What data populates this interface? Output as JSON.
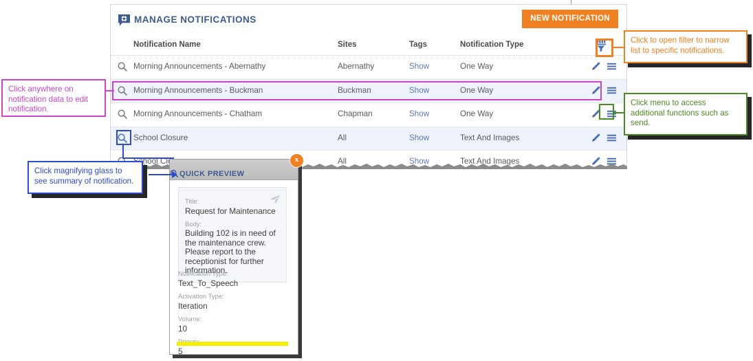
{
  "panel": {
    "title": "MANAGE NOTIFICATIONS",
    "title_icon": "speech-bubble-gear-icon",
    "new_button_label": "NEW NOTIFICATION",
    "filter_icon": "filter-funnel-icon"
  },
  "table": {
    "columns": [
      {
        "key": "name",
        "label": "Notification Name"
      },
      {
        "key": "sites",
        "label": "Sites"
      },
      {
        "key": "tags",
        "label": "Tags"
      },
      {
        "key": "type",
        "label": "Notification Type"
      }
    ],
    "rows": [
      {
        "name": "Morning Announcements - Abernathy",
        "sites": "Abernathy",
        "tags": "Show",
        "type": "One Way"
      },
      {
        "name": "Morning Announcements - Buckman",
        "sites": "Buckman",
        "tags": "Show",
        "type": "One Way"
      },
      {
        "name": "Morning Announcements - Chatham",
        "sites": "Chapman",
        "tags": "Show",
        "type": "One Way"
      },
      {
        "name": "School Closure",
        "sites": "All",
        "tags": "Show",
        "type": "Text And Images"
      },
      {
        "name": "School Closure",
        "sites": "All",
        "tags": "Show",
        "type": "Text And Images"
      }
    ],
    "row_icons": {
      "magnifier": "magnifying-glass-icon",
      "edit": "pencil-icon",
      "menu": "hamburger-menu-icon"
    }
  },
  "quick_preview": {
    "header": "QUICK PREVIEW",
    "header_icon": "magnifying-glass-icon",
    "close_label": "x",
    "send_icon": "paper-plane-icon",
    "fields": [
      {
        "label": "Title:",
        "value": "Request for Maintenance"
      },
      {
        "label": "Body:",
        "value": "Building 102 is in need of the maintenance crew. Please report to the receptionist for further information."
      }
    ],
    "meta": [
      {
        "label": "Notification Type:",
        "value": "Text_To_Speech"
      },
      {
        "label": "Activation Type:",
        "value": "Iteration"
      },
      {
        "label": "Volume:",
        "value": "10"
      },
      {
        "label": "Priority:",
        "value": "5"
      }
    ]
  },
  "callouts": {
    "edit": "Click anywhere on notification data to edit notification.",
    "magnify": "Click magnifying glass to see summary of notification.",
    "filter": "Click to open filter to narrow list to specific notifications.",
    "menu": "Click menu to access additional functions such as send."
  },
  "colors": {
    "brand_orange": "#ef8122",
    "title_blue": "#3d5a8c",
    "link_blue": "#5c77b4",
    "row_alt": "#eef3fb",
    "callout_purple": "#cc44cc",
    "callout_blue": "#2b4bd0",
    "callout_orange": "#ef8122",
    "callout_green": "#4a8a22",
    "highlight_yellow": "#f2f000"
  }
}
